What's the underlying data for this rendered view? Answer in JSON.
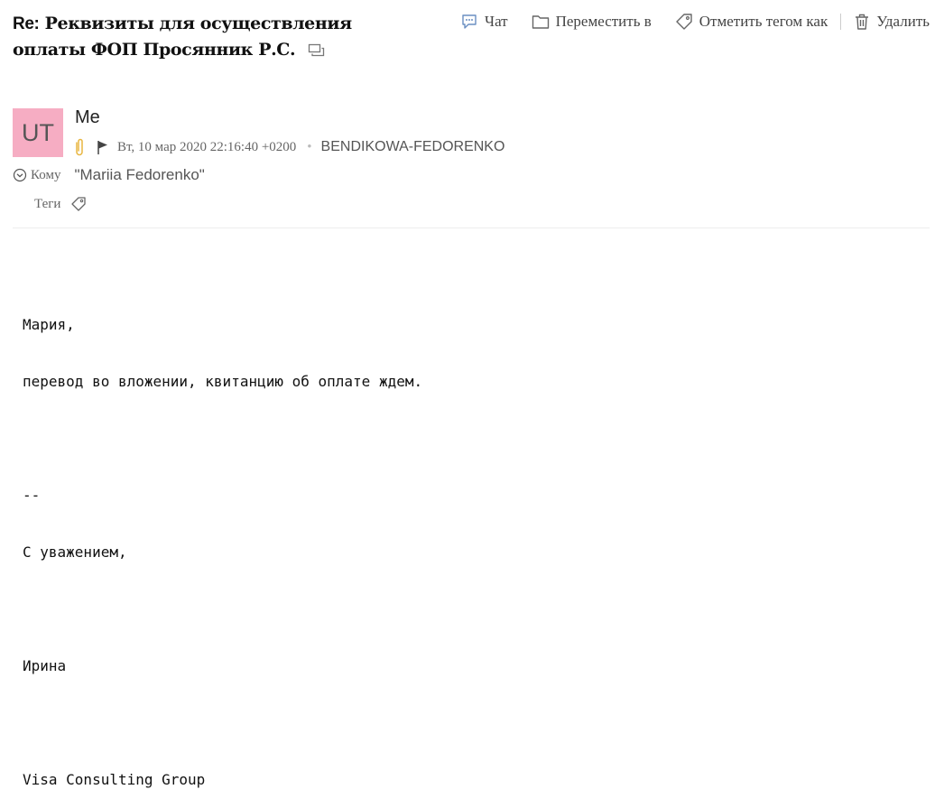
{
  "message": {
    "subject_prefix": "Re:",
    "subject": "Реквизиты для осуществления оплаты ФОП Просянник Р.С.",
    "sender": {
      "initials": "UT",
      "name": "Me",
      "avatar_color": "#f6adc3"
    },
    "date": "Вт, 10 мар 2020 22:16:40 +0200",
    "account": "BENDIKOWA-FEDORENKO",
    "to_label": "Кому",
    "recipient": "\"Mariia Fedorenko\"",
    "tags_label": "Теги",
    "attachment_icon_color": "#e8b640",
    "body": {
      "greeting": "Мария,",
      "line1": "перевод во вложении, квитанцию об оплате ждем.",
      "sig_sep": "--",
      "regards": "С уважением,",
      "name": "Ирина",
      "company": "Visa Consulting Group"
    }
  },
  "toolbar": {
    "chat_label": "Чат",
    "move_label": "Переместить в",
    "tag_label": "Отметить тегом как",
    "delete_label": "Удалить"
  }
}
